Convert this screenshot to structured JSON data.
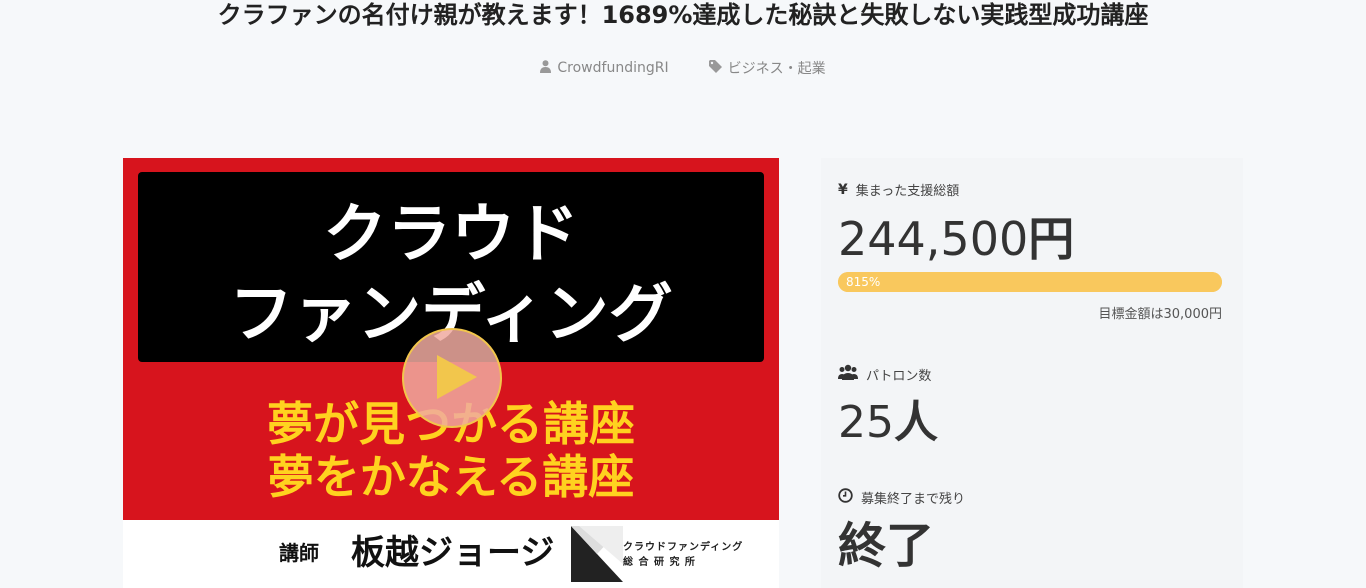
{
  "header": {
    "title": "クラファンの名付け親が教えます！1689%達成した秘訣と失敗しない実践型成功講座",
    "author": "CrowdfundingRI",
    "category": "ビジネス・起業"
  },
  "media": {
    "line1": "クラウド",
    "line2": "ファンディング",
    "yellow1": "夢が見つかる講座",
    "yellow2": "夢をかなえる講座",
    "instructor_label": "講師",
    "instructor_name": "板越ジョージ",
    "logo_line1": "クラウドファンディング",
    "logo_line2": "総 合 研 究 所"
  },
  "stats": {
    "funded_label": "集まった支援総額",
    "funded_number": "244,500",
    "funded_unit": "円",
    "progress_text": "815%",
    "progress_percent": 815,
    "goal_text": "目標金額は30,000円",
    "patrons_label": "パトロン数",
    "patrons_number": "25",
    "patrons_unit": "人",
    "remaining_label": "募集終了まで残り",
    "remaining_value": "終了"
  },
  "colors": {
    "accent": "#f9c85d",
    "media_red": "#d7141d",
    "media_yellow": "#ffd21f"
  }
}
